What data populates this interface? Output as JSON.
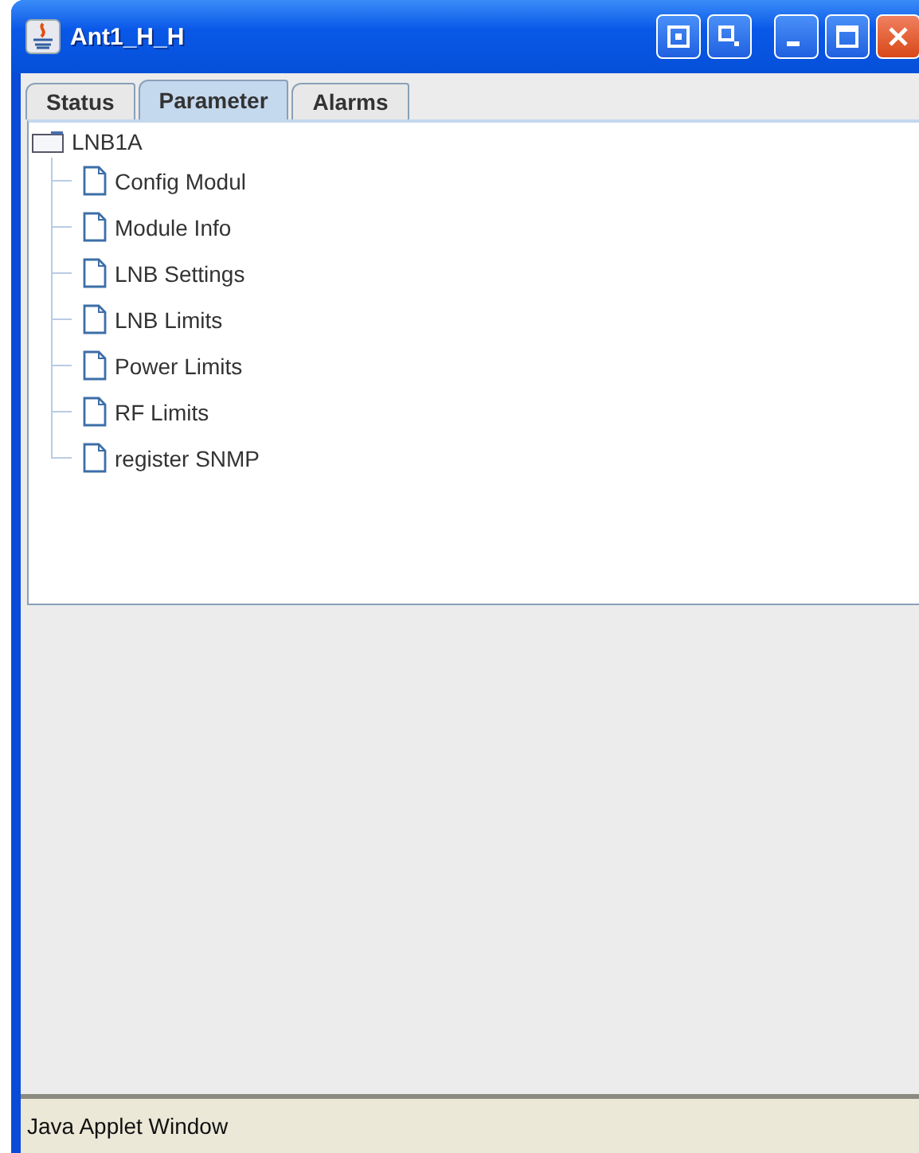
{
  "window": {
    "title": "Ant1_H_H"
  },
  "tabs": [
    {
      "label": "Status",
      "selected": false
    },
    {
      "label": "Parameter",
      "selected": true
    },
    {
      "label": "Alarms",
      "selected": false
    }
  ],
  "tree": {
    "label": "LNB1A",
    "expanded": true,
    "children": [
      {
        "label": "Config Modul"
      },
      {
        "label": "Module Info"
      },
      {
        "label": "LNB Settings"
      },
      {
        "label": "LNB Limits"
      },
      {
        "label": "Power Limits"
      },
      {
        "label": "RF Limits"
      },
      {
        "label": "register SNMP"
      }
    ]
  },
  "status_bar": {
    "text": "Java Applet Window"
  }
}
